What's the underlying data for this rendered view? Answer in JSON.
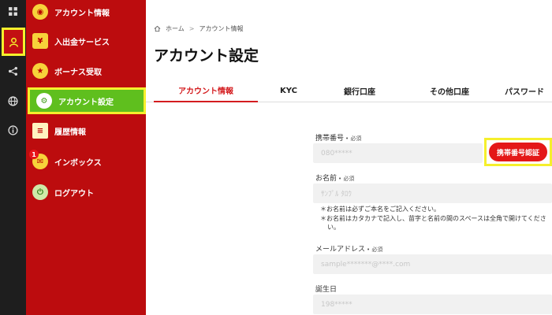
{
  "rail": {
    "items": [
      {
        "icon": "grid-icon"
      },
      {
        "icon": "user-icon"
      },
      {
        "icon": "share-icon"
      },
      {
        "icon": "globe-icon"
      },
      {
        "icon": "info-icon"
      }
    ]
  },
  "sidebar": {
    "items": [
      {
        "label": "アカウント情報",
        "icon": "account-icon"
      },
      {
        "label": "入出金サービス",
        "icon": "wallet-icon"
      },
      {
        "label": "ボーナス受取",
        "icon": "bonus-icon"
      },
      {
        "label": "アカウント設定",
        "icon": "settings-icon"
      },
      {
        "label": "履歴情報",
        "icon": "history-icon"
      },
      {
        "label": "インボックス",
        "icon": "inbox-icon",
        "badge": "1"
      },
      {
        "label": "ログアウト",
        "icon": "logout-icon"
      }
    ]
  },
  "breadcrumb": {
    "home": "ホーム",
    "separator": ">",
    "current": "アカウント情報"
  },
  "page": {
    "title": "アカウント設定"
  },
  "tabs": [
    {
      "label": "アカウント情報",
      "active": true
    },
    {
      "label": "KYC"
    },
    {
      "label": "銀行口座"
    },
    {
      "label": "その他口座"
    },
    {
      "label": "パスワード"
    }
  ],
  "form": {
    "phone": {
      "label": "携帯番号",
      "required": "• 必須",
      "value": "080*****"
    },
    "verify_button": "携帯番号認証",
    "name": {
      "label": "お名前",
      "required": "• 必須",
      "value": "ｻﾝﾌﾟﾙ ﾀﾛｳ"
    },
    "name_notes": [
      "＊お名前は必ずご本名をご記入ください。",
      "＊お名前はカタカナで記入し、苗字と名前の間のスペースは全角で開けてください。"
    ],
    "email": {
      "label": "メールアドレス",
      "required": "• 必須",
      "value": "sample*******@****.com"
    },
    "birthday": {
      "label": "誕生日",
      "value": "198*****"
    }
  },
  "colors": {
    "sidebar_bg": "#bc0c0e",
    "rail_bg": "#1e1e1e",
    "active_green": "#5fbf1e",
    "highlight_yellow": "#f5ef2c",
    "accent_red": "#d41c1f"
  }
}
